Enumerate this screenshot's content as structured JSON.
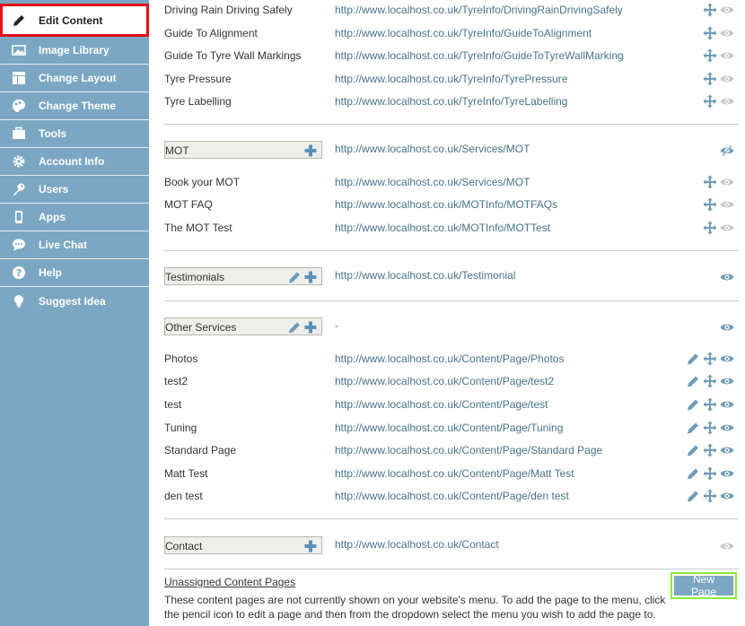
{
  "sidebar": {
    "items": [
      {
        "label": "Edit Content",
        "icon": "pencil-icon"
      },
      {
        "label": "Image Library",
        "icon": "image-icon"
      },
      {
        "label": "Change Layout",
        "icon": "layout-icon"
      },
      {
        "label": "Change Theme",
        "icon": "palette-icon"
      },
      {
        "label": "Tools",
        "icon": "briefcase-icon"
      },
      {
        "label": "Account Info",
        "icon": "gear-icon"
      },
      {
        "label": "Users",
        "icon": "key-icon"
      },
      {
        "label": "Apps",
        "icon": "phone-icon"
      },
      {
        "label": "Live Chat",
        "icon": "chat-icon"
      },
      {
        "label": "Help",
        "icon": "help-icon"
      },
      {
        "label": "Suggest Idea",
        "icon": "lightbulb-icon"
      }
    ]
  },
  "content": {
    "tyre_pages": [
      {
        "name": "Driving Rain Driving Safely",
        "url": "http://www.localhost.co.uk/TyreInfo/DrivingRainDrivingSafely"
      },
      {
        "name": "Guide To Alignment",
        "url": "http://www.localhost.co.uk/TyreInfo/GuideToAlignment"
      },
      {
        "name": "Guide To Tyre Wall Markings",
        "url": "http://www.localhost.co.uk/TyreInfo/GuideToTyreWallMarking"
      },
      {
        "name": "Tyre Pressure",
        "url": "http://www.localhost.co.uk/TyreInfo/TyrePressure"
      },
      {
        "name": "Tyre Labelling",
        "url": "http://www.localhost.co.uk/TyreInfo/TyreLabelling"
      }
    ],
    "mot": {
      "menu_label": "MOT",
      "url": "http://www.localhost.co.uk/Services/MOT",
      "pages": [
        {
          "name": "Book your MOT",
          "url": "http://www.localhost.co.uk/Services/MOT"
        },
        {
          "name": "MOT FAQ",
          "url": "http://www.localhost.co.uk/MOTInfo/MOTFAQs"
        },
        {
          "name": "The MOT Test",
          "url": "http://www.localhost.co.uk/MOTInfo/MOTTest"
        }
      ]
    },
    "testimonials": {
      "menu_label": "Testimonials",
      "url": "http://www.localhost.co.uk/Testimonial"
    },
    "other_services": {
      "menu_label": "Other Services",
      "url": "-",
      "pages": [
        {
          "name": "Photos",
          "url": "http://www.localhost.co.uk/Content/Page/Photos"
        },
        {
          "name": "test2",
          "url": "http://www.localhost.co.uk/Content/Page/test2"
        },
        {
          "name": "test",
          "url": "http://www.localhost.co.uk/Content/Page/test"
        },
        {
          "name": "Tuning",
          "url": "http://www.localhost.co.uk/Content/Page/Tuning"
        },
        {
          "name": "Standard Page",
          "url": "http://www.localhost.co.uk/Content/Page/Standard Page"
        },
        {
          "name": "Matt Test",
          "url": "http://www.localhost.co.uk/Content/Page/Matt Test"
        },
        {
          "name": "den test",
          "url": "http://www.localhost.co.uk/Content/Page/den test"
        }
      ]
    },
    "contact": {
      "menu_label": "Contact",
      "url": "http://www.localhost.co.uk/Contact"
    }
  },
  "unassigned": {
    "title": "Unassigned Content Pages",
    "description": "These content pages are not currently shown on your website's menu. To add the page to the menu, click the pencil icon to edit a page and then from the dropdown select the menu you wish to add the page to.",
    "new_page_label": "New Page"
  },
  "colors": {
    "sidebar": "#7ba7c2",
    "active_border": "#e0101a",
    "new_page_highlight": "#8bec3a",
    "icon": "#6e9bb6",
    "link": "#4a7389"
  }
}
